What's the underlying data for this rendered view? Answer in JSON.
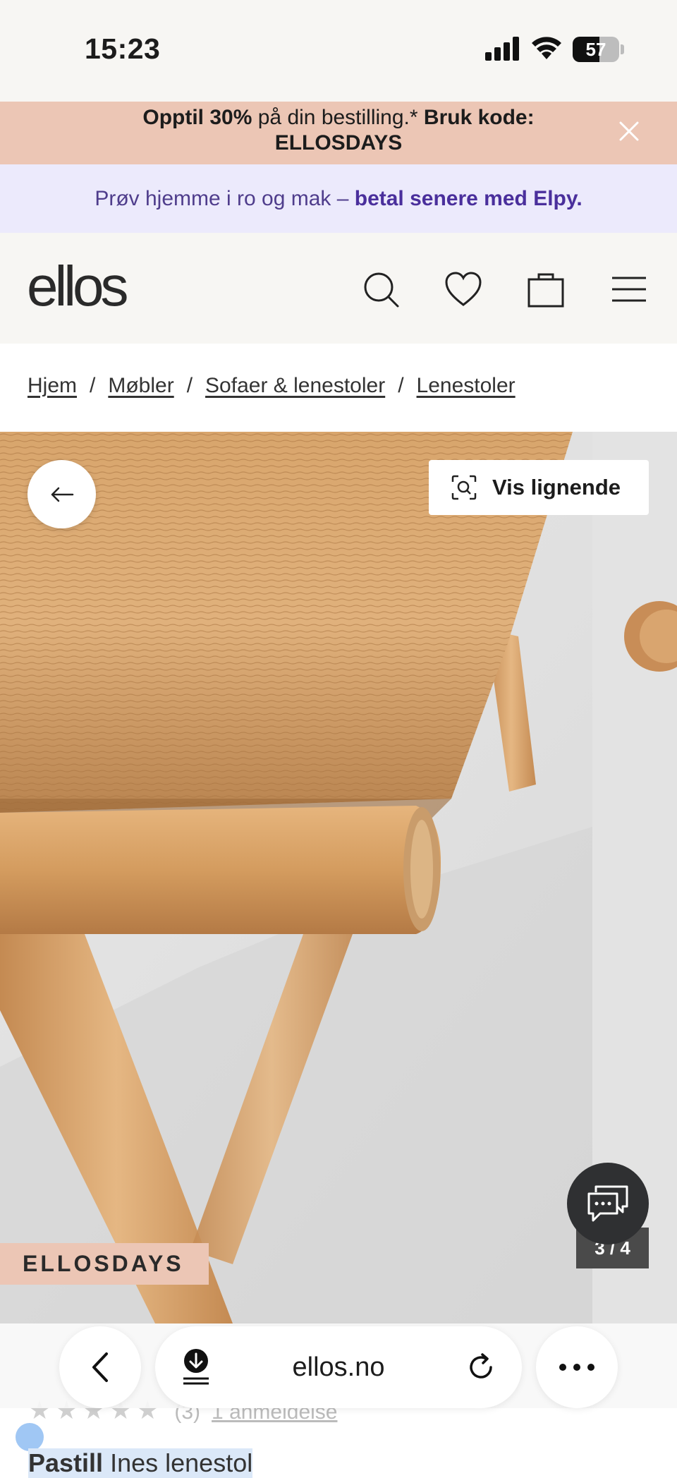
{
  "status_bar": {
    "time": "15:23",
    "battery": "57",
    "battery_level": 0.57
  },
  "promo": {
    "line1_bold": "Opptil 30%",
    "line1_rest": " på din bestilling.* ",
    "line1_code_label": "Bruk kode:",
    "code": "ELLOSDAYS"
  },
  "elpy": {
    "text": "Prøv hjemme i ro og mak – ",
    "bold": "betal senere med Elpy."
  },
  "header": {
    "logo": "ellos"
  },
  "breadcrumb": [
    "Hjem",
    "Møbler",
    "Sofaer & lenestoler",
    "Lenestoler"
  ],
  "breadcrumb_sep": "/",
  "product": {
    "similar_label": "Vis lignende",
    "image_counter": "3 / 4",
    "badge": "ELLOSDAYS",
    "stars": "★★★★★",
    "review_count": "(3)",
    "review_link": "1 anmeldelse",
    "brand": "Pastill",
    "name": "Ines lenestol"
  },
  "browser": {
    "url": "ellos.no"
  }
}
